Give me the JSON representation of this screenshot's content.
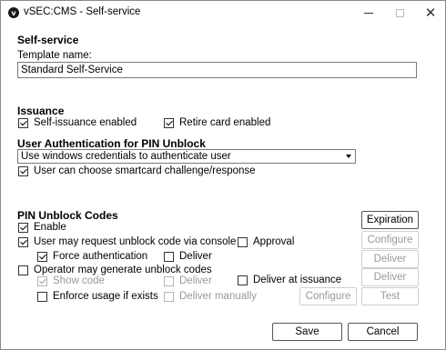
{
  "window": {
    "title": "vSEC:CMS - Self-service",
    "icon_glyph": "v"
  },
  "self_service": {
    "heading": "Self-service",
    "template_name_label": "Template name:",
    "template_name_value": "Standard Self-Service"
  },
  "issuance": {
    "heading": "Issuance",
    "self_issuance_label": "Self-issuance enabled",
    "self_issuance_checked": true,
    "retire_card_label": "Retire card enabled",
    "retire_card_checked": true
  },
  "user_auth": {
    "heading": "User Authentication for PIN Unblock",
    "select_value": "Use windows credentials to authenticate user",
    "smartcard_label": "User can choose smartcard challenge/response",
    "smartcard_checked": true
  },
  "pin_unblock": {
    "heading": "PIN Unblock Codes",
    "enable_label": "Enable",
    "enable_checked": true,
    "console_label": "User may request unblock code via console",
    "console_checked": true,
    "approval_label": "Approval",
    "approval_checked": false,
    "force_auth_label": "Force authentication",
    "force_auth_checked": true,
    "deliver1_label": "Deliver",
    "deliver1_checked": false,
    "operator_label": "Operator may generate unblock codes",
    "operator_checked": false,
    "show_code_label": "Show code",
    "show_code_checked": true,
    "deliver2_label": "Deliver",
    "deliver2_checked": false,
    "deliver_issuance_label": "Deliver at issuance",
    "deliver_issuance_checked": false,
    "enforce_label": "Enforce usage if exists",
    "enforce_checked": false,
    "deliver_manually_label": "Deliver manually",
    "deliver_manually_checked": false
  },
  "buttons": {
    "expiration": "Expiration",
    "configure_top": "Configure",
    "deliver_1": "Deliver",
    "deliver_2": "Deliver",
    "configure_bottom": "Configure",
    "test": "Test",
    "save": "Save",
    "cancel": "Cancel"
  },
  "icons": {
    "app": "app-logo-icon",
    "minimize": "minimize-icon",
    "maximize": "maximize-icon",
    "close": "close-icon",
    "dropdown": "chevron-down-icon"
  }
}
